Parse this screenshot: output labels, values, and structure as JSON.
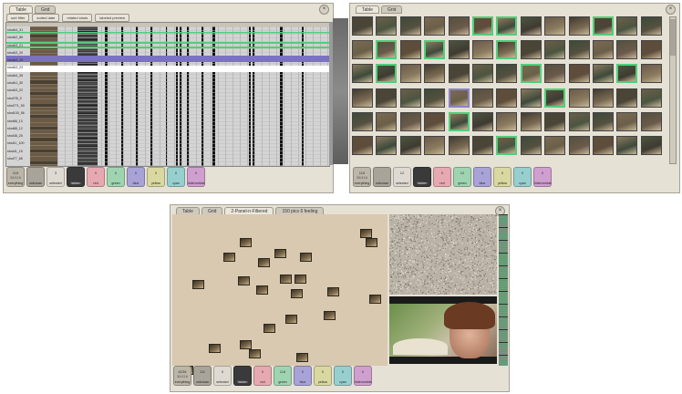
{
  "panel_a": {
    "tabs": [
      "Table",
      "Grid"
    ],
    "filters": [
      "sort filter",
      "sorted date",
      "related shots",
      "labeled preview"
    ],
    "column_header_label": "AnnotationLabel",
    "rows": [
      "shotA4_31",
      "shotA2_86",
      "shotA3_21",
      "shotA3_20",
      "shotA3_19",
      "shotA3_23",
      "shotA4_35",
      "shotA1_30",
      "shotA3_22",
      "shot7f9_0",
      "shot771_90",
      "shot100_56",
      "shot66_13",
      "shot88_12",
      "shot38_25",
      "shot11_100",
      "shot41_15",
      "shot77_65"
    ],
    "buttons": [
      {
        "count": "115",
        "count2": "38/116",
        "label": "everything",
        "color": "#bcb6a9"
      },
      {
        "count": "",
        "count2": "",
        "label": "unknown",
        "color": "#a9a49a"
      },
      {
        "count": "3",
        "count2": "",
        "label": "selected",
        "color": "#dedad2"
      },
      {
        "count": "",
        "count2": "",
        "label": "hidden",
        "color": "#3a3a3a"
      },
      {
        "count": "0",
        "count2": "",
        "label": "red",
        "color": "#e6a9b1"
      },
      {
        "count": "0",
        "count2": "",
        "label": "green",
        "color": "#9fd4b0"
      },
      {
        "count": "0",
        "count2": "",
        "label": "blue",
        "color": "#a8a3d6"
      },
      {
        "count": "0",
        "count2": "",
        "label": "yellow",
        "color": "#d9d8a1"
      },
      {
        "count": "0",
        "count2": "",
        "label": "cyan",
        "color": "#97cfcf"
      },
      {
        "count": "0",
        "count2": "",
        "label": "hide/unhide",
        "color": "#cf9fcf"
      }
    ]
  },
  "panel_b": {
    "tabs": [
      "Table",
      "Grid"
    ],
    "buttons": [
      {
        "count": "115",
        "count2": "38/116",
        "label": "everything",
        "color": "#bcb6a9"
      },
      {
        "count": "",
        "count2": "",
        "label": "unknown",
        "color": "#a9a49a"
      },
      {
        "count": "12",
        "count2": "",
        "label": "selected",
        "color": "#dedad2"
      },
      {
        "count": "",
        "count2": "",
        "label": "hidden",
        "color": "#3a3a3a"
      },
      {
        "count": "0",
        "count2": "",
        "label": "red",
        "color": "#e6a9b1"
      },
      {
        "count": "12",
        "count2": "",
        "label": "green",
        "color": "#9fd4b0"
      },
      {
        "count": "0",
        "count2": "",
        "label": "blue",
        "color": "#a8a3d6"
      },
      {
        "count": "0",
        "count2": "",
        "label": "yellow",
        "color": "#d9d8a1"
      },
      {
        "count": "0",
        "count2": "",
        "label": "cyan",
        "color": "#97cfcf"
      },
      {
        "count": "0",
        "count2": "",
        "label": "hide/unhide",
        "color": "#cf9fcf"
      }
    ]
  },
  "panel_c": {
    "tabs": [
      "Table",
      "Grid",
      "2-Panel-n-Filtered",
      "150 pics 6 feeling"
    ],
    "buttons": [
      {
        "count": "8236",
        "count2": "36/116",
        "label": "everything",
        "color": "#bcb6a9"
      },
      {
        "count": "111",
        "count2": "",
        "label": "unknown",
        "color": "#a9a49a"
      },
      {
        "count": "0",
        "count2": "",
        "label": "selected",
        "color": "#dedad2"
      },
      {
        "count": "",
        "count2": "",
        "label": "hidden",
        "color": "#3a3a3a"
      },
      {
        "count": "0",
        "count2": "",
        "label": "red",
        "color": "#e6a9b1"
      },
      {
        "count": "116",
        "count2": "",
        "label": "green",
        "color": "#9fd4b0"
      },
      {
        "count": "0",
        "count2": "",
        "label": "blue",
        "color": "#a8a3d6"
      },
      {
        "count": "0",
        "count2": "",
        "label": "yellow",
        "color": "#d9d8a1"
      },
      {
        "count": "0",
        "count2": "",
        "label": "cyan",
        "color": "#97cfcf"
      },
      {
        "count": "0",
        "count2": "",
        "label": "hide/unhide",
        "color": "#cf9fcf"
      }
    ]
  },
  "icons": {
    "close": "close-icon",
    "scroll": "scrollbar"
  }
}
